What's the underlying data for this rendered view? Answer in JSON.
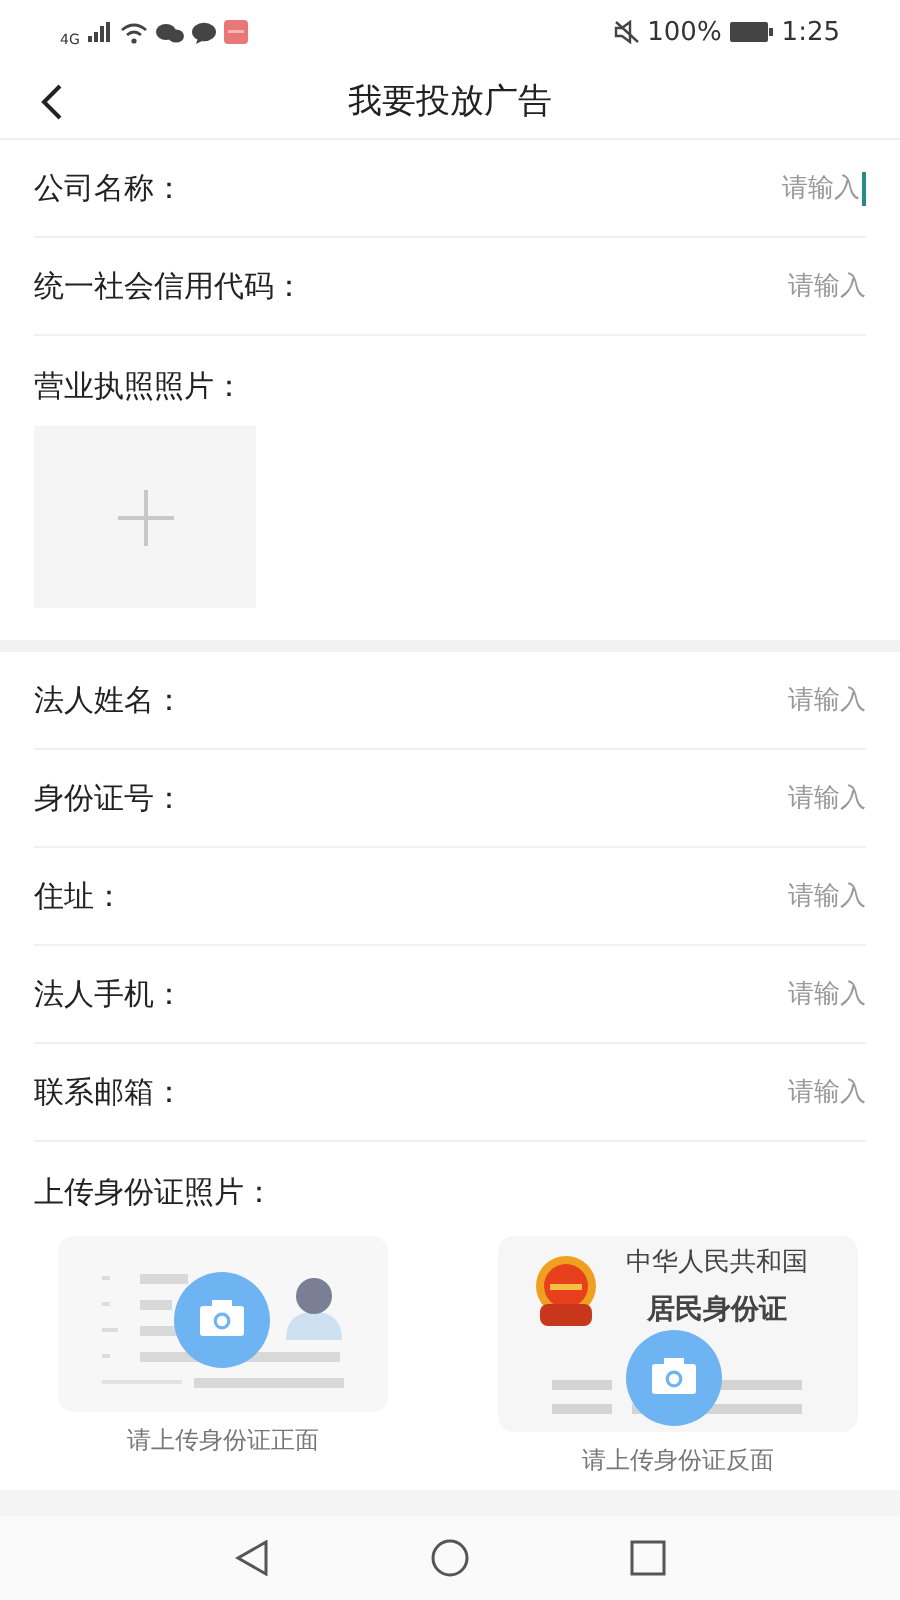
{
  "status_bar": {
    "network": "4G",
    "battery": "100%",
    "time": "1:25"
  },
  "header": {
    "title": "我要投放广告"
  },
  "company_fields": [
    {
      "label": "公司名称：",
      "placeholder": "请输入",
      "focused": true
    },
    {
      "label": "统一社会信用代码：",
      "placeholder": "请输入",
      "focused": false
    }
  ],
  "license": {
    "label": "营业执照照片："
  },
  "person_fields": [
    {
      "label": "法人姓名：",
      "placeholder": "请输入",
      "focused": false
    },
    {
      "label": "身份证号：",
      "placeholder": "请输入",
      "focused": false
    },
    {
      "label": "住址：",
      "placeholder": "请输入",
      "focused": false
    },
    {
      "label": "法人手机：",
      "placeholder": "请输入",
      "focused": false
    },
    {
      "label": "联系邮箱：",
      "placeholder": "请输入",
      "focused": false
    }
  ],
  "id_upload": {
    "label": "上传身份证照片：",
    "cards": [
      {
        "kind": "front",
        "caption": "请上传身份证正面"
      },
      {
        "kind": "back",
        "caption": "请上传身份证反面",
        "lines": [
          "中华人民共和国",
          "居民身份证"
        ]
      }
    ]
  }
}
